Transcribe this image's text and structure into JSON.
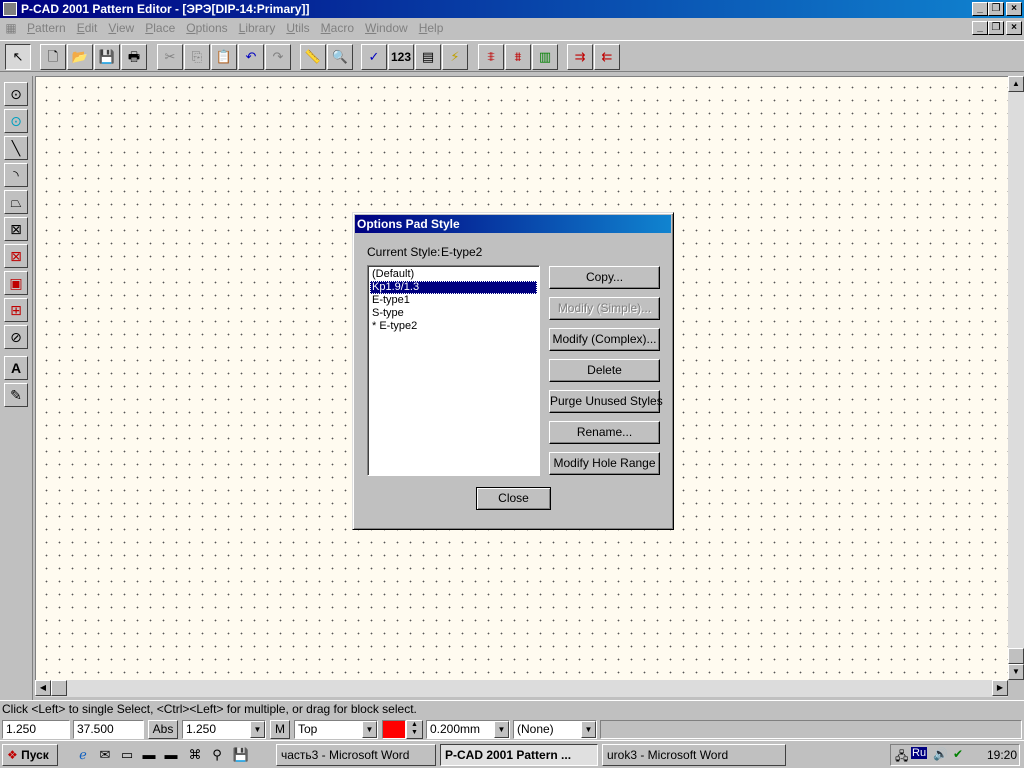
{
  "window": {
    "title": "P-CAD 2001 Pattern Editor - [ЭРЭ[DIP-14:Primary]]",
    "btn_min": "_",
    "btn_restore": "❐",
    "btn_close": "×"
  },
  "menu": [
    "Pattern",
    "Edit",
    "View",
    "Place",
    "Options",
    "Library",
    "Utils",
    "Macro",
    "Window",
    "Help"
  ],
  "toolbar": {
    "num_label": "123"
  },
  "dialog": {
    "title": "Options Pad Style",
    "current_style_label": "Current Style:",
    "current_style_value": "E-type2",
    "styles": [
      "(Default)",
      "Kp1.9/1.3",
      "E-type1",
      "S-type",
      "* E-type2"
    ],
    "selected_index": 1,
    "buttons": {
      "copy": "Copy...",
      "modify_simple": "Modify (Simple)...",
      "modify_complex": "Modify (Complex)...",
      "delete": "Delete",
      "purge": "Purge Unused Styles",
      "rename": "Rename...",
      "hole_range": "Modify Hole Range"
    },
    "close": "Close"
  },
  "status": {
    "message": "Click <Left> to single Select, <Ctrl><Left> for multiple, or drag for block select.",
    "x": "1.250",
    "y": "37.500",
    "abs": "Abs",
    "grid": "1.250",
    "units": "M",
    "layer": "Top",
    "width": "0.200mm",
    "none": "(None)",
    "layer_color": "#ff0000"
  },
  "taskbar": {
    "start": "Пуск",
    "tasks": [
      "часть3 - Microsoft Word",
      "P-CAD 2001 Pattern ...",
      "urok3 - Microsoft Word"
    ],
    "active_index": 1,
    "lang": "Ru",
    "clock": "19:20"
  }
}
